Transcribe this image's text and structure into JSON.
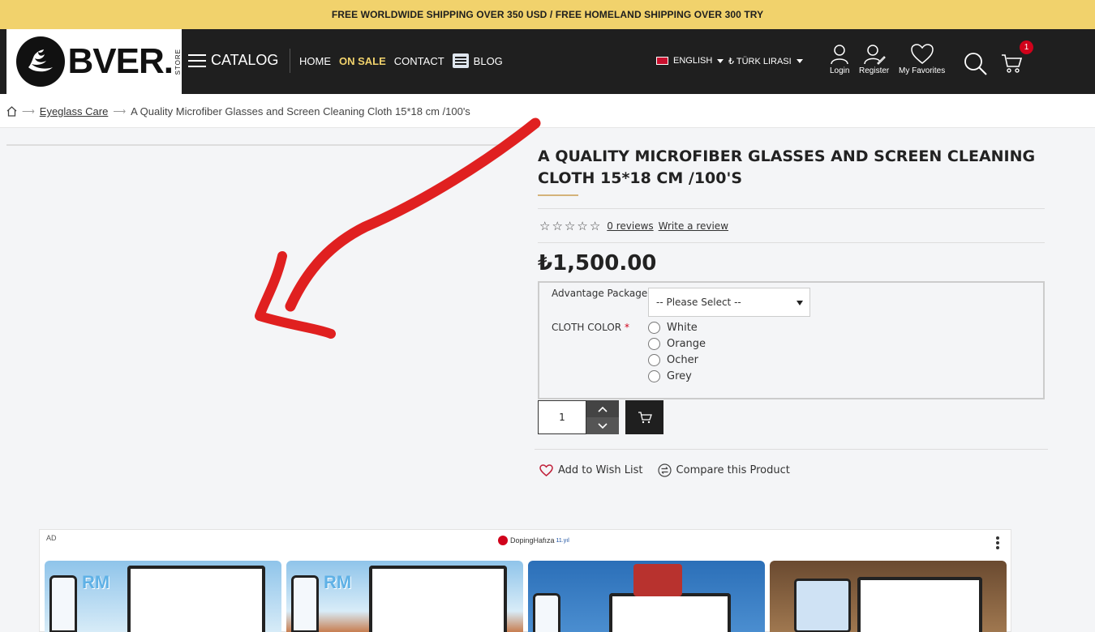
{
  "promo": {
    "text": "FREE WORLDWIDE SHIPPING OVER 350 USD / FREE HOMELAND SHIPPING OVER 300 TRY"
  },
  "header": {
    "logo_text": "BVER.",
    "logo_store": "STORE",
    "catalog_label": "CATALOG",
    "nav": {
      "home": "HOME",
      "sale": "ON SALE",
      "contact": "CONTACT",
      "blog": "BLOG"
    },
    "language": "ENGLISH",
    "currency": "₺ TÜRK LIRASI",
    "login": "Login",
    "register": "Register",
    "favorites": "My Favorites",
    "cart_count": "1"
  },
  "breadcrumb": {
    "category": "Eyeglass Care",
    "current": "A Quality Microfiber Glasses and Screen Cleaning Cloth 15*18 cm /100's"
  },
  "product": {
    "title": "A Quality Microfiber Glasses and Screen Cleaning Cloth 15*18 cm /100's",
    "reviews_link": "0 reviews",
    "write_review": "Write a review",
    "price": "₺1,500.00",
    "options": {
      "package_label": "Advantage Package",
      "package_placeholder": "-- Please Select --",
      "color_label": "CLOTH COLOR",
      "required_mark": "*",
      "colors": [
        "White",
        "Orange",
        "Ocher",
        "Grey"
      ]
    },
    "quantity": "1",
    "wishlist": "Add to Wish List",
    "compare": "Compare this Product"
  },
  "ad": {
    "label": "AD",
    "brand": "DopingHafıza",
    "brand_sub": "11.yıl",
    "card_text": "RM"
  },
  "colors": {
    "promo_bg": "#f1d26c",
    "header_bg": "#1f1f1f",
    "sale_accent": "#f1d26c",
    "badge": "#d0021b",
    "annotation_arrow": "#e02020"
  }
}
